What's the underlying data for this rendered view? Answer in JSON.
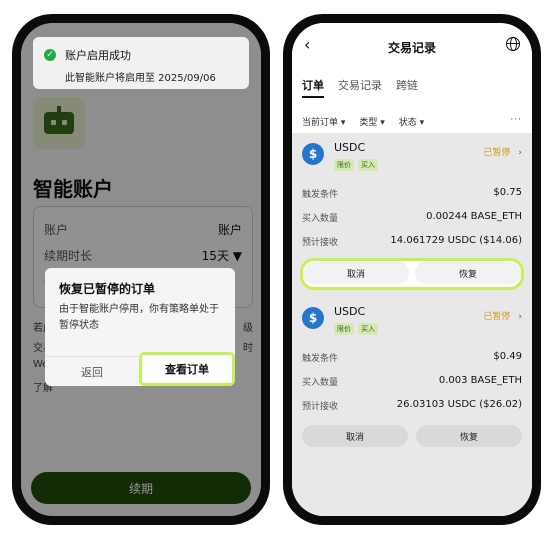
{
  "left": {
    "toast": {
      "title": "账户启用成功",
      "message": "此智能账户将启用至 2025/09/06"
    },
    "page_title": "智能账户",
    "card": {
      "row1": {
        "label": "账户",
        "value": "账户"
      },
      "row2": {
        "label": "续期时长",
        "value": "15天 ▼"
      }
    },
    "partial_text": {
      "line1": "若此",
      "line2": "交易",
      "line3": "We",
      "line4": "了解",
      "right1": "级",
      "right2": "时",
      "row_prefix": "4"
    },
    "dialog": {
      "title": "恢复已暂停的订单",
      "body": "由于智能账户停用，你有策略单处于暂停状态",
      "back": "返回",
      "view_orders": "查看订单"
    },
    "renew_button": "续期"
  },
  "right": {
    "header": {
      "title": "交易记录"
    },
    "tabs": [
      {
        "label": "订单",
        "active": true
      },
      {
        "label": "交易记录",
        "active": false
      },
      {
        "label": "跨链",
        "active": false
      }
    ],
    "filters": {
      "f1": "当前订单 ▾",
      "f2": "类型 ▾",
      "f3": "状态 ▾",
      "more": "···"
    },
    "orders": [
      {
        "coin": "USDC",
        "tag1": "限价",
        "tag2": "买入",
        "status": "已暂停",
        "trigger_label": "触发条件",
        "trigger_value": "$0.75",
        "qty_label": "买入数量",
        "qty_value": "0.00244 BASE_ETH",
        "recv_label": "预计接收",
        "recv_value": "14.061729 USDC ($14.06)",
        "cancel": "取消",
        "resume": "恢复"
      },
      {
        "coin": "USDC",
        "tag1": "限价",
        "tag2": "买入",
        "status": "已暂停",
        "trigger_label": "触发条件",
        "trigger_value": "$0.49",
        "qty_label": "买入数量",
        "qty_value": "0.003 BASE_ETH",
        "recv_label": "预计接收",
        "recv_value": "26.03103 USDC ($26.02)",
        "cancel": "取消",
        "resume": "恢复"
      }
    ]
  },
  "colors": {
    "accent_highlight": "#c7ef5b",
    "brand_green": "#244d0a",
    "paused": "#d29a1a",
    "usdc": "#2775ca"
  }
}
